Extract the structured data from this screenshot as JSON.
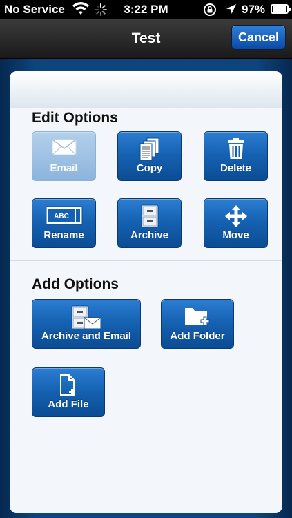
{
  "status_bar": {
    "carrier": "No Service",
    "time": "3:22 PM",
    "battery_percent": "97%"
  },
  "nav": {
    "title": "Test",
    "cancel_label": "Cancel"
  },
  "edit_options": {
    "title": "Edit Options",
    "buttons": [
      {
        "label": "Email",
        "icon": "envelope-icon",
        "enabled": false
      },
      {
        "label": "Copy",
        "icon": "copy-icon",
        "enabled": true
      },
      {
        "label": "Delete",
        "icon": "trash-icon",
        "enabled": true
      },
      {
        "label": "Rename",
        "icon": "rename-icon",
        "enabled": true
      },
      {
        "label": "Archive",
        "icon": "file-cabinet-icon",
        "enabled": true
      },
      {
        "label": "Move",
        "icon": "move-arrows-icon",
        "enabled": true
      }
    ]
  },
  "rename_icon_text": "ABC",
  "add_options": {
    "title": "Add Options",
    "buttons": [
      {
        "label": "Archive and Email",
        "icon": "archive-email-icon",
        "enabled": true
      },
      {
        "label": "Add Folder",
        "icon": "add-folder-icon",
        "enabled": true
      },
      {
        "label": "Add File",
        "icon": "add-file-icon",
        "enabled": true
      }
    ]
  },
  "colors": {
    "accent": "#1561b1",
    "disabled": "#8cb4dc",
    "nav_bg": "#2a2a2a",
    "frame_bg": "#0e447c"
  }
}
